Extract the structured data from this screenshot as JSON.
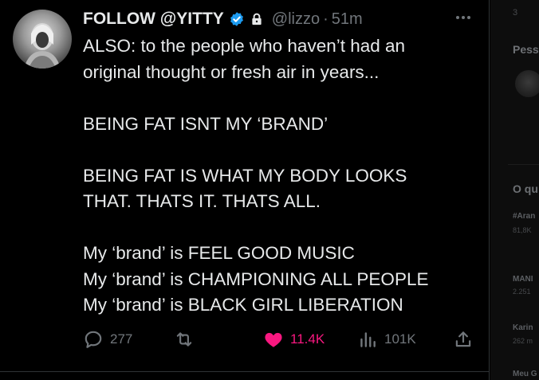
{
  "tweet": {
    "display_name": "FOLLOW @YITTY",
    "handle": "@lizzo",
    "separator": "·",
    "time": "51m",
    "lines": [
      "ALSO: to the people who haven’t had an",
      "original thought or fresh air in years...",
      "",
      "BEING FAT ISNT MY ‘BRAND’",
      "",
      "BEING FAT IS WHAT MY BODY LOOKS",
      "THAT. THATS IT. THATS ALL.",
      "",
      "My ‘brand’ is FEEL GOOD MUSIC",
      "My ‘brand’ is CHAMPIONING ALL PEOPLE",
      "My ‘brand’ is BLACK GIRL LIBERATION"
    ],
    "stats": {
      "replies": "277",
      "retweets": "",
      "likes": "11.4K",
      "views": "101K"
    }
  },
  "sidebar": {
    "top_count": "3",
    "heading_people": "Pess",
    "heading_trends": "O qu",
    "trend_1": "#Aran",
    "trend_1_meta": "81,8K",
    "trend_1_sub": "",
    "trend_2_meta": "",
    "trend_2": "MANI",
    "trend_2_count": "2.251",
    "trend_3_meta": "",
    "trend_3": "Karin",
    "trend_3_count": "262 m",
    "trend_4_meta": "",
    "trend_4": "Meu G"
  },
  "colors": {
    "background": "#000000",
    "text": "#e7e9ea",
    "muted": "#71767b",
    "like": "#f91880",
    "verified": "#1d9bf0"
  }
}
